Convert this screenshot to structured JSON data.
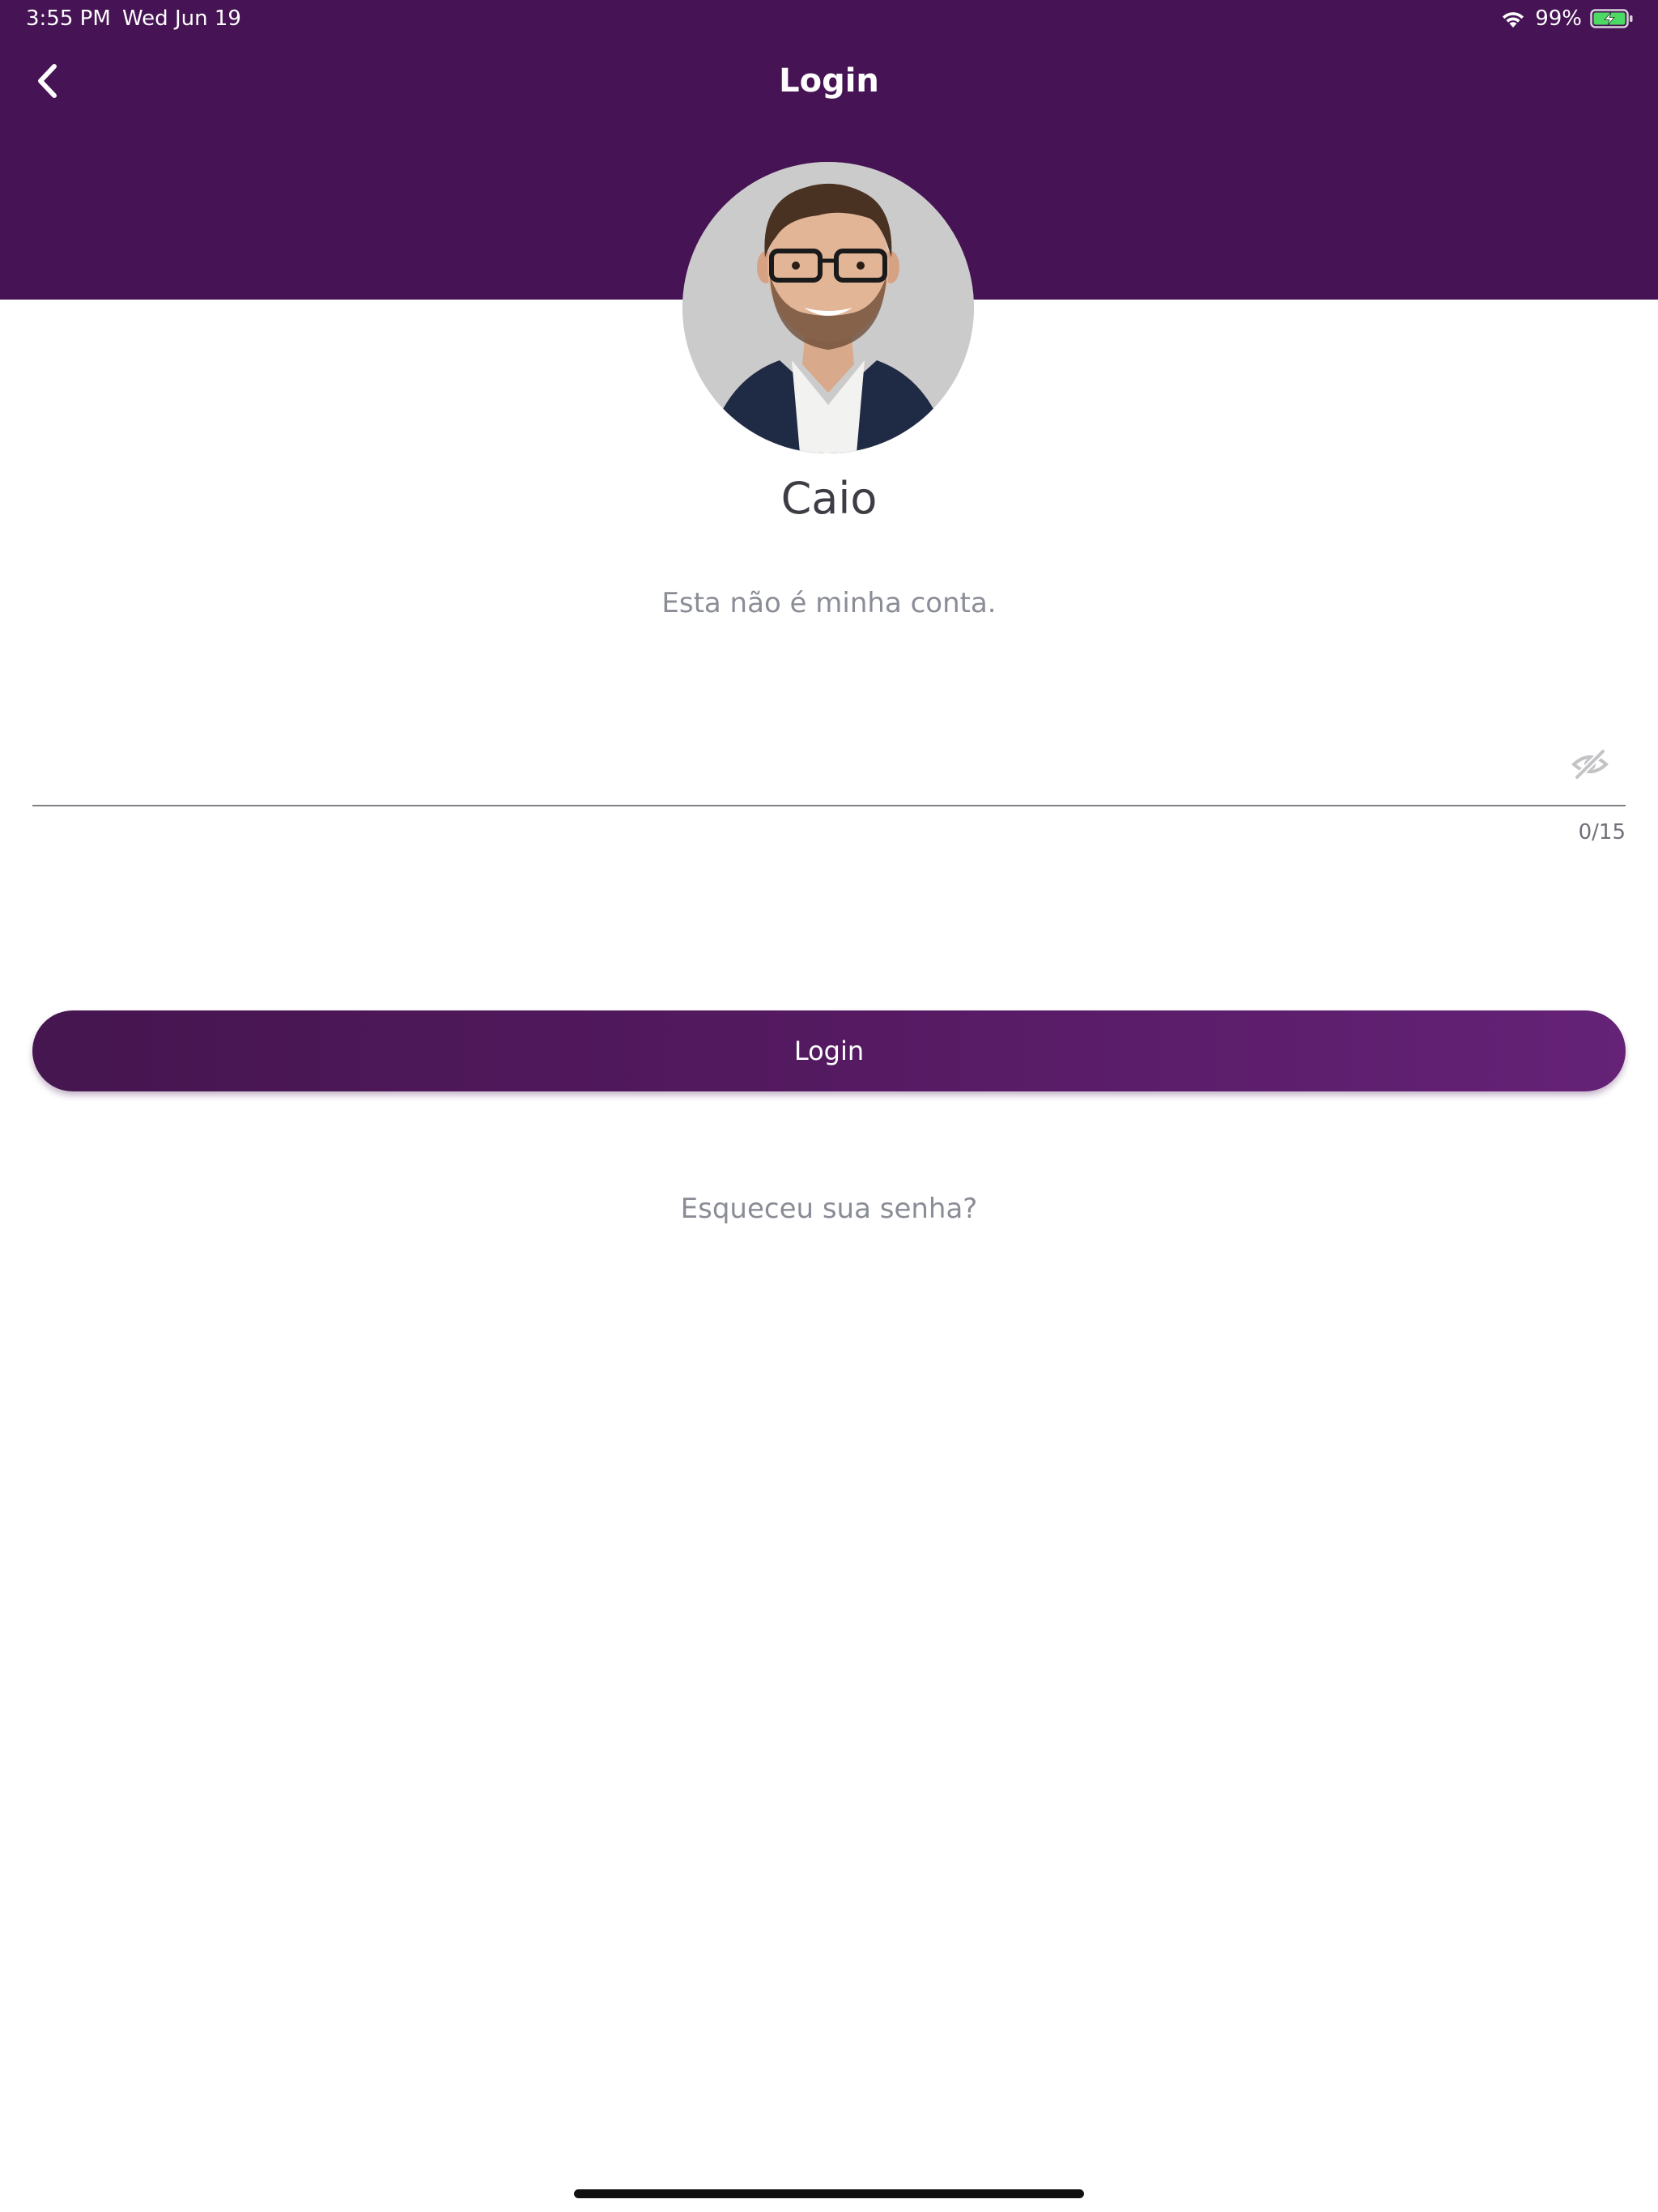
{
  "status_bar": {
    "time": "3:55 PM",
    "date": "Wed Jun 19",
    "battery_text": "99%",
    "battery_level": 0.99
  },
  "header": {
    "title": "Login",
    "back_icon": "chevron-left-icon",
    "background_color": "#461454"
  },
  "profile": {
    "name": "Caio",
    "not_my_account": "Esta não é minha conta."
  },
  "password": {
    "value": "",
    "placeholder": "",
    "counter": "0/15",
    "visibility_icon": "eye-off-icon"
  },
  "actions": {
    "login_label": "Login",
    "forgot_password": "Esqueceu sua senha?"
  },
  "colors": {
    "brand": "#461454",
    "button_gradient_start": "#45164f",
    "button_gradient_end": "#652277",
    "secondary_text": "#8a8d96",
    "battery_charging": "#4cd964"
  }
}
